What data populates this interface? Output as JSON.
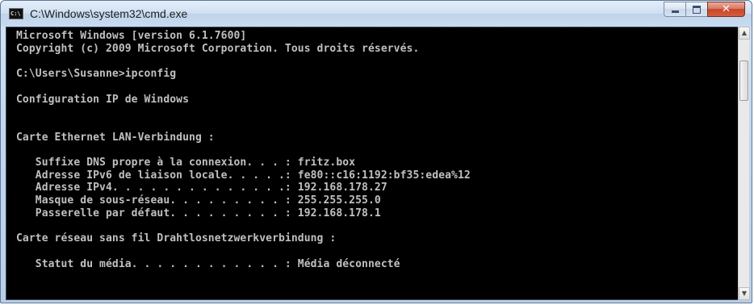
{
  "window": {
    "title": "C:\\Windows\\system32\\cmd.exe",
    "app_icon": "cmd-icon",
    "app_icon_text": "C:\\",
    "controls": {
      "minimize": "minimize-icon",
      "maximize": "maximize-icon",
      "close": "close-icon",
      "close_glyph": "✕"
    }
  },
  "console": {
    "lines": [
      "Microsoft Windows [version 6.1.7600]",
      "Copyright (c) 2009 Microsoft Corporation. Tous droits réservés.",
      "",
      "C:\\Users\\Susanne>ipconfig",
      "",
      "Configuration IP de Windows",
      "",
      "",
      "Carte Ethernet LAN-Verbindung :",
      "",
      "   Suffixe DNS propre à la connexion. . . : fritz.box",
      "   Adresse IPv6 de liaison locale. . . . .: fe80::c16:1192:bf35:edea%12",
      "   Adresse IPv4. . . . . . . . . . . . . .: 192.168.178.27",
      "   Masque de sous-réseau. . . . . . . . . : 255.255.255.0",
      "   Passerelle par défaut. . . . . . . . . : 192.168.178.1",
      "",
      "Carte réseau sans fil Drahtlosnetzwerkverbindung :",
      "",
      "   Statut du média. . . . . . . . . . . . : Média déconnecté"
    ],
    "text_color": "#c0c0c0",
    "background": "#000000"
  },
  "scrollbar": {
    "up_arrow": "▲",
    "down_arrow": "▼"
  }
}
